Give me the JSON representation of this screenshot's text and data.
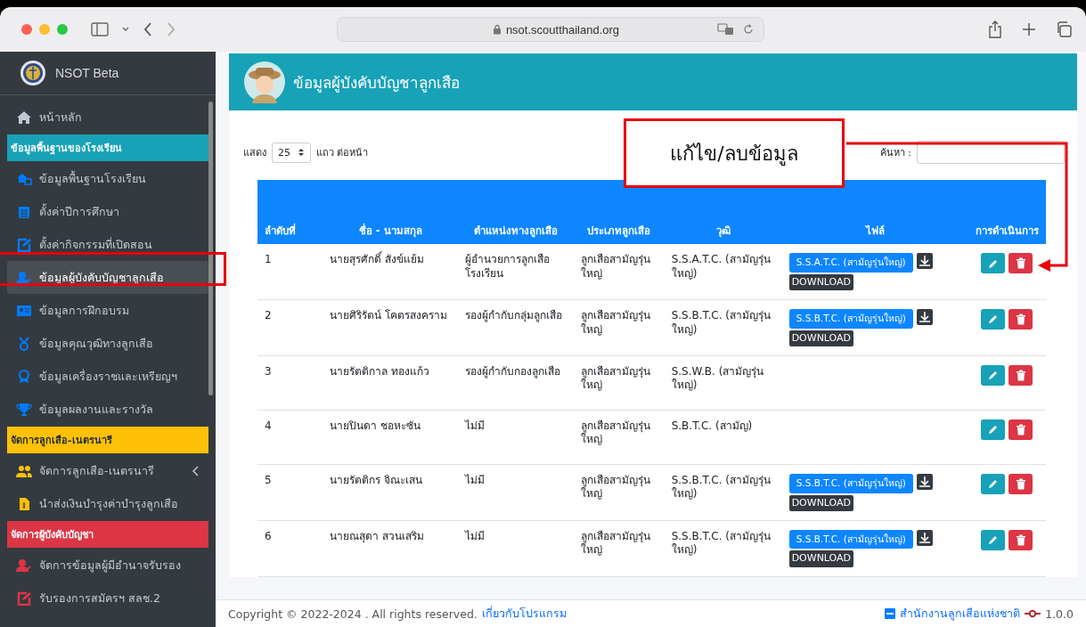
{
  "browser": {
    "url": "nsot.scoutthailand.org"
  },
  "sidebar": {
    "brand": "NSOT Beta",
    "items": [
      {
        "kind": "link",
        "label": "หน้าหลัก",
        "selected": false,
        "submenu": false
      },
      {
        "kind": "section",
        "label": "ข้อมูลพื้นฐานของโรงเรียน",
        "color": "#17a2b8"
      },
      {
        "kind": "link",
        "label": "ข้อมูลพื้นฐานโรงเรียน",
        "selected": false,
        "submenu": false,
        "color": "#007bff"
      },
      {
        "kind": "link",
        "label": "ตั้งค่าปีการศึกษา",
        "selected": false,
        "submenu": false,
        "color": "#007bff"
      },
      {
        "kind": "link",
        "label": "ตั้งค่ากิจกรรมที่เปิดสอน",
        "selected": false,
        "submenu": false,
        "color": "#007bff"
      },
      {
        "kind": "link",
        "label": "ข้อมูลผู้บังคับบัญชาลูกเสือ",
        "selected": true,
        "submenu": false,
        "color": "#007bff"
      },
      {
        "kind": "link",
        "label": "ข้อมูลการฝึกอบรม",
        "selected": false,
        "submenu": false,
        "color": "#007bff"
      },
      {
        "kind": "link",
        "label": "ข้อมูลคุณวุฒิทางลูกเสือ",
        "selected": false,
        "submenu": false,
        "color": "#007bff"
      },
      {
        "kind": "link",
        "label": "ข้อมูลเครื่องราชและเหรียญฯ",
        "selected": false,
        "submenu": false,
        "color": "#007bff"
      },
      {
        "kind": "link",
        "label": "ข้อมูลผลงานและรางวัล",
        "selected": false,
        "submenu": false,
        "color": "#007bff"
      },
      {
        "kind": "section",
        "label": "จัดการลูกเสือ-เนตรนารี",
        "color": "#ffc107"
      },
      {
        "kind": "link",
        "label": "จัดการลูกเสือ-เนตรนารี",
        "selected": false,
        "submenu": true,
        "color": "#ffc107"
      },
      {
        "kind": "link",
        "label": "นำส่งเงินบำรุงค่าบำรุงลูกเสือ",
        "selected": false,
        "submenu": false,
        "color": "#ffc107"
      },
      {
        "kind": "section",
        "label": "จัดการผู้บังคับบัญชา",
        "color": "#dc3545"
      },
      {
        "kind": "link",
        "label": "จัดการข้อมูลผู้มีอำนาจรับรอง",
        "selected": false,
        "submenu": false,
        "color": "#dc3545"
      },
      {
        "kind": "link",
        "label": "รับรองการสมัครฯ สลช.2",
        "selected": false,
        "submenu": false,
        "color": "#dc3545"
      }
    ]
  },
  "page": {
    "title": "ข้อมูลผู้บังคับบัญชาลูกเสือ"
  },
  "controls": {
    "show_label": "แสดง",
    "page_size": "25",
    "per_page_label": "แถว ต่อหน้า",
    "search_label": "ค้นหา :"
  },
  "annotation": {
    "label": "แก้ไข/ลบข้อมูล"
  },
  "table": {
    "columns": [
      "ลำดับที่",
      "ชื่อ - นามสกุล",
      "ตำแหน่งทางลูกเสือ",
      "ประเภทลูกเสือ",
      "วุฒิ",
      "ไฟล์",
      "การดำเนินการ"
    ],
    "rows": [
      {
        "no": "1",
        "name": "นายสุรศักดิ์  สังข์แย้ม",
        "position": "ผู้อำนวยการลูกเสือโรงเรียน",
        "type": "ลูกเสือสามัญรุ่นใหญ่",
        "qualification": "S.S.A.T.C. (สามัญรุ่นใหญ่)",
        "file": {
          "label": "S.S.A.T.C. (สามัญรุ่นใหญ่)",
          "download": "DOWNLOAD"
        }
      },
      {
        "no": "2",
        "name": "นายศิริรัตน์  โคตรสงคราม",
        "position": "รองผู้กำกับกลุ่มลูกเสือ",
        "type": "ลูกเสือสามัญรุ่นใหญ่",
        "qualification": "S.S.B.T.C. (สามัญรุ่นใหญ่)",
        "file": {
          "label": "S.S.B.T.C. (สามัญรุ่นใหญ่)",
          "download": "DOWNLOAD"
        }
      },
      {
        "no": "3",
        "name": "นายรัตติกาล  ทองแก้ว",
        "position": "รองผู้กำกับกองลูกเสือ",
        "type": "ลูกเสือสามัญรุ่นใหญ่",
        "qualification": "S.S.W.B. (สามัญรุ่นใหญ่)"
      },
      {
        "no": "4",
        "name": "นายปินดา  ชอหะซัน",
        "position": "ไม่มี",
        "type": "ลูกเสือสามัญรุ่นใหญ่",
        "qualification": "S.B.T.C. (สามัญ)"
      },
      {
        "no": "5",
        "name": "นายรัตติกร  จิณะเสน",
        "position": "ไม่มี",
        "type": "ลูกเสือสามัญรุ่นใหญ่",
        "qualification": "S.S.B.T.C. (สามัญรุ่นใหญ่)",
        "file": {
          "label": "S.S.B.T.C. (สามัญรุ่นใหญ่)",
          "download": "DOWNLOAD"
        }
      },
      {
        "no": "6",
        "name": "นายณสุดา  สวนเสริม",
        "position": "ไม่มี",
        "type": "ลูกเสือสามัญรุ่นใหญ่",
        "qualification": "S.S.B.T.C. (สามัญรุ่นใหญ่)",
        "file": {
          "label": "S.S.B.T.C. (สามัญรุ่นใหญ่)",
          "download": "DOWNLOAD"
        }
      }
    ]
  },
  "footer": {
    "copyright": "Copyright © 2022-2024 . All rights reserved.",
    "link": "เกี่ยวกับโปรแกรม",
    "org": "สำนักงานลูกเสือแห่งชาติ",
    "version": "1.0.0"
  }
}
